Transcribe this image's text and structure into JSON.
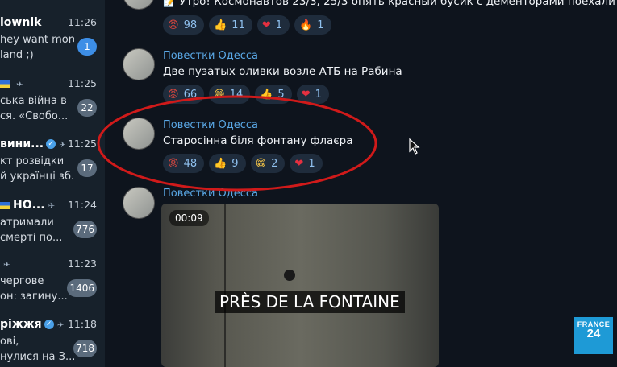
{
  "sidebar": {
    "chats": [
      {
        "name": "lownik",
        "time": "11:26",
        "preview1": "hey want more",
        "preview2": "land ;)",
        "badge": "1"
      },
      {
        "name": "",
        "time": "11:25",
        "preview1": "ська війна в",
        "preview2": "ся. «Свобо...",
        "badge": "22"
      },
      {
        "name": "вини...",
        "time": "11:25",
        "preview1": "кт розвідки",
        "preview2": "й українці зб...",
        "badge": "17"
      },
      {
        "name": "НО...",
        "time": "11:24",
        "preview1": "атримали",
        "preview2": "смерті по...",
        "badge": "776"
      },
      {
        "name": "",
        "time": "11:23",
        "preview1": "чергове",
        "preview2": "он: загину...",
        "badge": "1406"
      },
      {
        "name": "ріжжя",
        "time": "11:18",
        "preview1": "ові,",
        "preview2": "нулися на З...",
        "badge": "718"
      }
    ]
  },
  "messages": [
    {
      "text": "Утро! Космонавтов 23/3, 25/3 опять красный бусик с дементорами поехали кош",
      "reactions": [
        {
          "count": "98"
        },
        {
          "count": "11"
        },
        {
          "count": "1"
        },
        {
          "count": "1"
        }
      ]
    },
    {
      "author": "Повестки Одесса",
      "text": "Две пузатых оливки возле АТБ на Рабина",
      "reactions": [
        {
          "count": "66"
        },
        {
          "count": "14"
        },
        {
          "count": "5"
        },
        {
          "count": "1"
        }
      ]
    },
    {
      "author": "Повестки Одесса",
      "text": "Старосінна біля фонтану флаєра",
      "reactions": [
        {
          "count": "48"
        },
        {
          "count": "9"
        },
        {
          "count": "2"
        },
        {
          "count": "1"
        }
      ]
    },
    {
      "author": "Повестки Одесса",
      "video_duration": "00:09"
    }
  ],
  "subtitle": "PRÈS DE LA FONTAINE",
  "logo": {
    "line1": "FRANCE",
    "line2": "24"
  },
  "colors": {
    "accent": "#5aa8e6",
    "annotation": "#d01a1a",
    "badge_blue": "#3d8ee6"
  }
}
